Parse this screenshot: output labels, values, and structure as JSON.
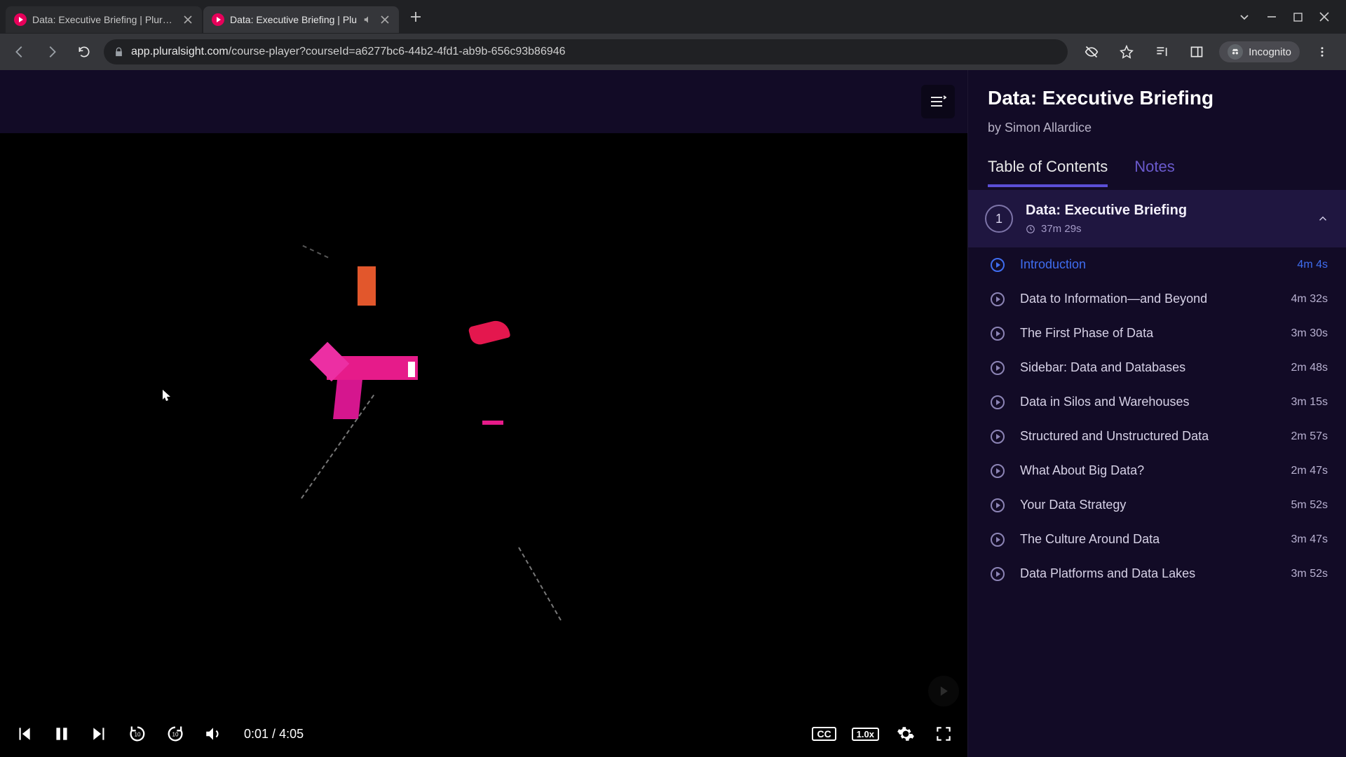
{
  "browser": {
    "tabs": [
      {
        "title": "Data: Executive Briefing | Pluralsi",
        "active": false,
        "audio": false
      },
      {
        "title": "Data: Executive Briefing | Plu",
        "active": true,
        "audio": true
      }
    ],
    "url_domain": "app.pluralsight.com",
    "url_path": "/course-player?courseId=a6277bc6-44b2-4fd1-ab9b-656c93b86946",
    "incognito_label": "Incognito"
  },
  "player": {
    "time_current": "0:01",
    "time_total": "4:05",
    "speed_label": "1.0x",
    "cc_label": "CC"
  },
  "course": {
    "title": "Data: Executive Briefing",
    "author": "by Simon Allardice",
    "tabs": {
      "toc": "Table of Contents",
      "notes": "Notes"
    },
    "module": {
      "number": "1",
      "title": "Data: Executive Briefing",
      "duration": "37m 29s"
    },
    "lessons": [
      {
        "title": "Introduction",
        "duration": "4m 4s",
        "current": true
      },
      {
        "title": "Data to Information—and Beyond",
        "duration": "4m 32s"
      },
      {
        "title": "The First Phase of Data",
        "duration": "3m 30s"
      },
      {
        "title": "Sidebar: Data and Databases",
        "duration": "2m 48s"
      },
      {
        "title": "Data in Silos and Warehouses",
        "duration": "3m 15s"
      },
      {
        "title": "Structured and Unstructured Data",
        "duration": "2m 57s"
      },
      {
        "title": "What About Big Data?",
        "duration": "2m 47s"
      },
      {
        "title": "Your Data Strategy",
        "duration": "5m 52s"
      },
      {
        "title": "The Culture Around Data",
        "duration": "3m 47s"
      },
      {
        "title": "Data Platforms and Data Lakes",
        "duration": "3m 52s"
      }
    ]
  }
}
